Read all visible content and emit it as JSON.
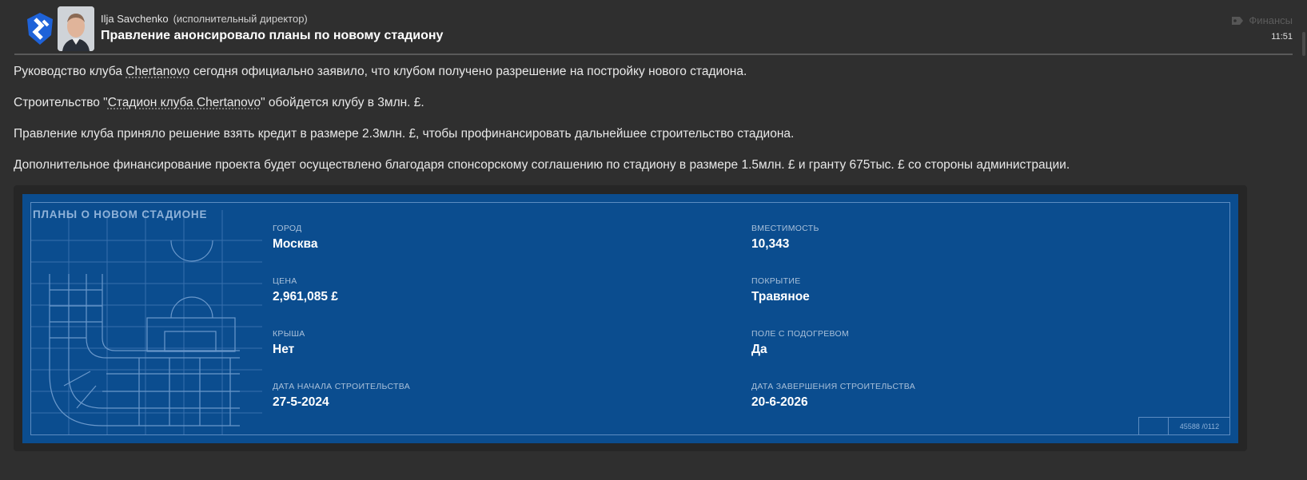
{
  "header": {
    "sender_name": "Ilja Savchenko",
    "sender_role": "(исполнительный директор)",
    "headline": "Правление анонсировало планы по новому стадиону",
    "category": "Финансы",
    "time": "11:51"
  },
  "body": {
    "p1_before": "Руководство клуба ",
    "p1_link": "Chertanovo",
    "p1_after": " сегодня официально заявило, что клубом получено разрешение на постройку нового стадиона.",
    "p2_before": "Строительство \"",
    "p2_link": "Стадион клуба Chertanovo",
    "p2_after": "\" обойдется клубу в 3млн. £.",
    "p3": "Правление клуба приняло решение взять кредит в размере 2.3млн. £, чтобы профинансировать дальнейшее строительство стадиона.",
    "p4": "Дополнительное финансирование проекта будет осуществлено благодаря спонсорскому соглашению по стадиону в размере 1.5млн. £ и гранту 675тыс. £ со стороны администрации."
  },
  "blueprint": {
    "title": "ПЛАНЫ О НОВОМ СТАДИОНЕ",
    "fields": {
      "city_label": "ГОРОД",
      "city_value": "Москва",
      "capacity_label": "ВМЕСТИМОСТЬ",
      "capacity_value": "10,343",
      "price_label": "ЦЕНА",
      "price_value": "2,961,085 £",
      "surface_label": "ПОКРЫТИЕ",
      "surface_value": "Травяное",
      "roof_label": "КРЫША",
      "roof_value": "Нет",
      "heating_label": "ПОЛЕ С ПОДОГРЕВОМ",
      "heating_value": "Да",
      "start_label": "ДАТА НАЧАЛА СТРОИТЕЛЬСТВА",
      "start_value": "27-5-2024",
      "end_label": "ДАТА ЗАВЕРШЕНИЯ СТРОИТЕЛЬСТВА",
      "end_value": "20-6-2026"
    },
    "stamp_code": "45588 /0112"
  },
  "colors": {
    "background": "#2f2f2f",
    "blueprint": "#0b4d8f",
    "blueprint_lines": "#5c8cc1"
  },
  "icons": {
    "club_logo": "chertanovo-logo",
    "category_icon": "tag-icon"
  }
}
